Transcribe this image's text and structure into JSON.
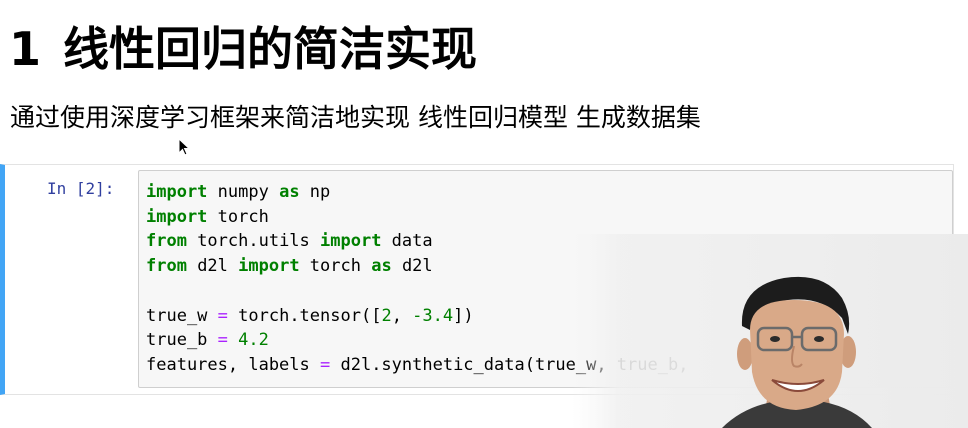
{
  "heading": {
    "number": "1",
    "title": "线性回归的简洁实现"
  },
  "intro": {
    "text": "通过使用深度学习框架来简洁地实现 线性回归模型 生成数据集"
  },
  "cell": {
    "prompt": "In [2]:",
    "code": {
      "line1": {
        "kw1": "import",
        "mod": " numpy ",
        "kw2": "as",
        "alias": " np"
      },
      "line2": {
        "kw1": "import",
        "mod": " torch"
      },
      "line3": {
        "kw1": "from",
        "mod": " torch.utils ",
        "kw2": "import",
        "name": " data"
      },
      "line4": {
        "kw1": "from",
        "mod": " d2l ",
        "kw2": "import",
        "mid": " torch ",
        "kw3": "as",
        "alias": " d2l"
      },
      "line6": {
        "pre": "true_w ",
        "eq": "=",
        "mid": " torch.tensor([",
        "n1": "2",
        "sep": ", ",
        "n2": "-3.4",
        "post": "])"
      },
      "line7": {
        "pre": "true_b ",
        "eq": "=",
        "sp": " ",
        "n1": "4.2"
      },
      "line8": {
        "pre": "features, labels ",
        "eq": "=",
        "post": " d2l.synthetic_data(true_w, true_b, "
      }
    }
  },
  "icons": {
    "cursor": "mouse-pointer-icon",
    "webcam": "presenter-webcam-overlay"
  },
  "colors": {
    "cell_accent": "#42a5f5",
    "prompt": "#303f9f",
    "keyword": "#008000",
    "operator": "#aa22ff",
    "number": "#008000"
  }
}
